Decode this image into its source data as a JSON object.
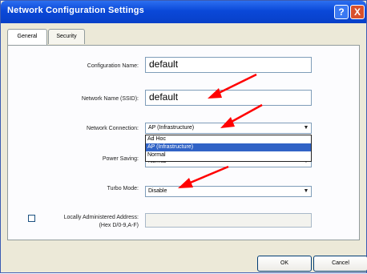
{
  "window": {
    "title": "Network Configuration Settings",
    "help_label": "?",
    "close_label": "X"
  },
  "tabs": [
    {
      "label": "General"
    },
    {
      "label": "Security"
    }
  ],
  "form": {
    "config_name": {
      "label": "Configuration Name:",
      "value": "default"
    },
    "ssid": {
      "label": "Network Name (SSID):",
      "value": "default"
    },
    "connection": {
      "label": "Network Connection:",
      "value": "AP (Infrastructure)",
      "options": [
        "Ad Hoc",
        "AP (Infrastructure)",
        "Normal"
      ]
    },
    "power_saving": {
      "label": "Power Saving:",
      "value": "Normal"
    },
    "turbo_mode": {
      "label": "Turbo Mode:",
      "value": "Disable"
    },
    "laa": {
      "label_line1": "Locally Administered Address:",
      "label_line2": "(Hex D/0-9,A-F)",
      "value": "",
      "checked": false
    }
  },
  "buttons": {
    "ok": "OK",
    "cancel": "Cancel"
  },
  "icons": {
    "dropdown": "chevron-down-icon",
    "annotation": "red-arrow-icon"
  },
  "colors": {
    "titlebar": "#0a48d8",
    "highlight": "#3163c6",
    "annotation": "#ff0000"
  }
}
